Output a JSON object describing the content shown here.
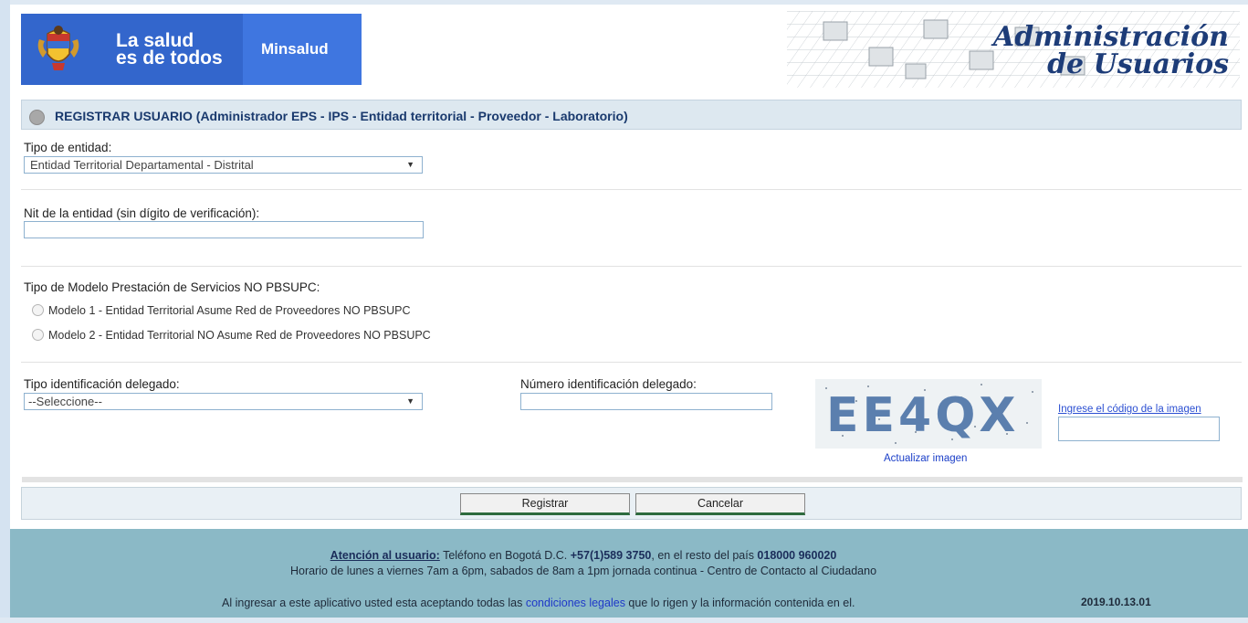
{
  "header": {
    "slogan_line1": "La salud",
    "slogan_line2": "es de todos",
    "ministry": "Minsalud",
    "app_title_line1": "Administración",
    "app_title_line2": "de Usuarios"
  },
  "section": {
    "title": "REGISTRAR USUARIO (Administrador EPS - IPS - Entidad territorial - Proveedor - Laboratorio)"
  },
  "form": {
    "entity_type_label": "Tipo de entidad:",
    "entity_type_value": "Entidad Territorial Departamental - Distrital",
    "nit_label": "Nit de la entidad (sin dígito de verificación):",
    "nit_value": "",
    "model_label": "Tipo de Modelo Prestación de Servicios NO PBSUPC:",
    "model_options": [
      "Modelo 1 - Entidad Territorial Asume Red de Proveedores NO PBSUPC",
      "Modelo 2 - Entidad Territorial NO Asume Red de Proveedores NO PBSUPC"
    ],
    "delegate_id_type_label": "Tipo identificación delegado:",
    "delegate_id_type_value": "--Seleccione--",
    "delegate_id_number_label": "Número identificación delegado:",
    "delegate_id_number_value": "",
    "captcha_text": "EE4QX",
    "captcha_refresh": "Actualizar imagen",
    "captcha_hint": "Ingrese el código de la imagen",
    "captcha_value": ""
  },
  "actions": {
    "register": "Registrar",
    "cancel": "Cancelar"
  },
  "footer": {
    "attention_label": "Atención al usuario:",
    "phone_text_1": " Teléfono en Bogotá D.C. ",
    "phone_bogota": "+57(1)589 3750",
    "phone_text_2": ", en el resto del país ",
    "phone_country": "018000 960020",
    "hours": "Horario de lunes a viernes 7am a 6pm, sabados de 8am a 1pm jornada continua - Centro de Contacto al Ciudadano",
    "legal_text_1": "Al ingresar a este aplicativo usted esta aceptando todas las ",
    "legal_link": "condiciones legales",
    "legal_text_2": " que lo  rigen y la información contenida en el.",
    "version": "2019.10.13.01"
  },
  "colors": {
    "brand_blue": "#3366cc",
    "section_bg": "#dde8f0",
    "footer_bg": "#8bb9c6",
    "link_blue": "#1f39c8"
  }
}
